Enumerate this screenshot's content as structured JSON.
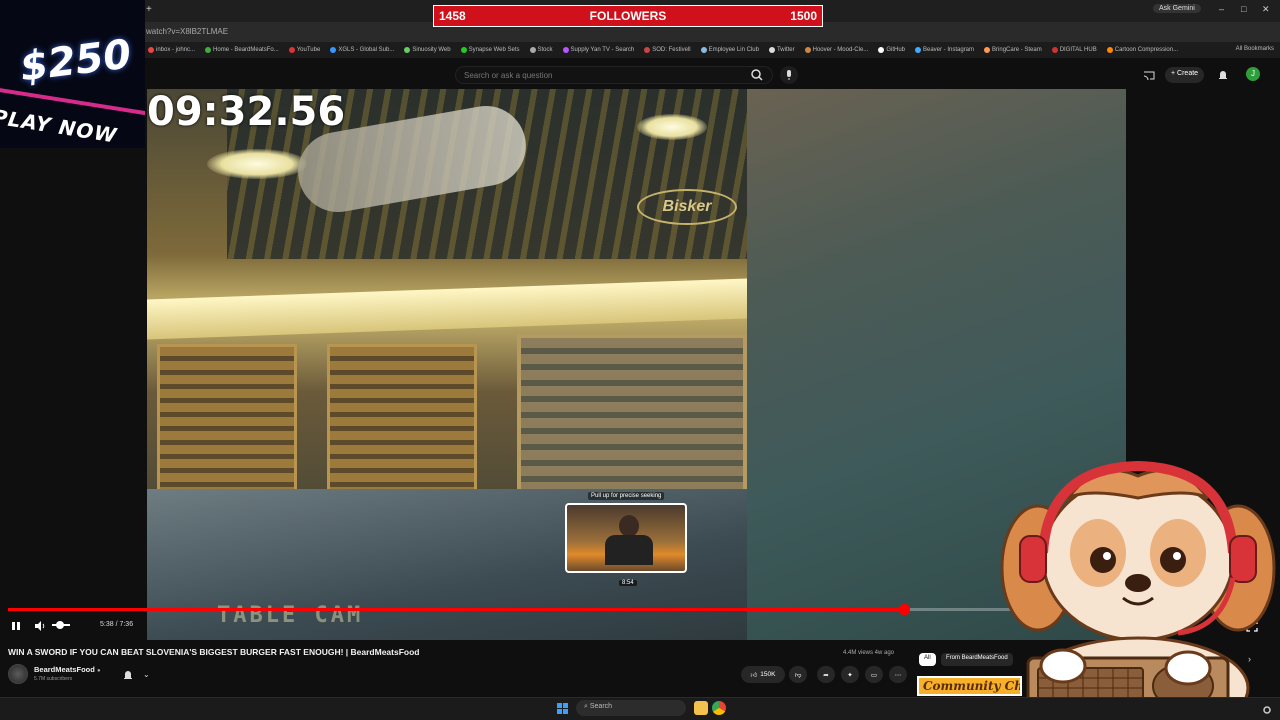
{
  "followers": {
    "current": "1458",
    "label": "FOLLOWERS",
    "goal": "1500"
  },
  "promo": {
    "amount": "$250",
    "cta": "PLAY NOW",
    "accent": "#d62b8b"
  },
  "browser": {
    "address": "watch?v=X8lB2TLMAE",
    "ask_gemini": "Ask Gemini",
    "bookmarks": [
      "inbox - johnc...",
      "Home - BeardMeatsFo...",
      "YouTube",
      "XGLS - Global Sub...",
      "Sinuosity Web",
      "Synapse Web Sets",
      "Stock",
      "Supply Yan TV - Search",
      "SOD: Festivell",
      "Employee Lin Club",
      "Twitter",
      "Hoover - Mood-Cle...",
      "GitHub",
      "Beaver - Instagram",
      "BringCare - Steam",
      "DIGITAL HUB",
      "Cartoon Compression..."
    ],
    "all_bookmarks": "All Bookmarks"
  },
  "youtube": {
    "search_placeholder": "Search or ask a question",
    "create_label": "Create",
    "avatar_letter": "J",
    "brand_color": "#ff0000"
  },
  "video": {
    "timer": "09:32.56",
    "overlay_caption": "TABLE CAM",
    "preview_hint": "Pull up for precise seeking",
    "preview_time": "8:54",
    "time_display": "5:38 / 7:36",
    "progress": 0.712
  },
  "below": {
    "title": "WIN A SWORD IF YOU CAN BEAT SLOVENIA'S BIGGEST BURGER FAST ENOUGH! | BeardMeatsFood",
    "channel_name": "BeardMeatsFood",
    "verified_icon": "verified-icon",
    "subscribers": "5.7M subscribers",
    "views": "4.4M views  4w ago",
    "likes": "150K",
    "chip_all": "All",
    "chip_from": "From BeardMeatsFood",
    "community": "Community Chat"
  },
  "taskbar": {
    "search": "Search"
  },
  "icons": [
    "search-icon",
    "mic-icon",
    "bell-icon",
    "pause-icon",
    "volume-icon",
    "fullscreen-icon",
    "like-icon",
    "dislike-icon",
    "share-icon",
    "sparkle-icon",
    "save-icon",
    "more-icon",
    "windows-icon",
    "chrome-icon",
    "folder-icon"
  ]
}
